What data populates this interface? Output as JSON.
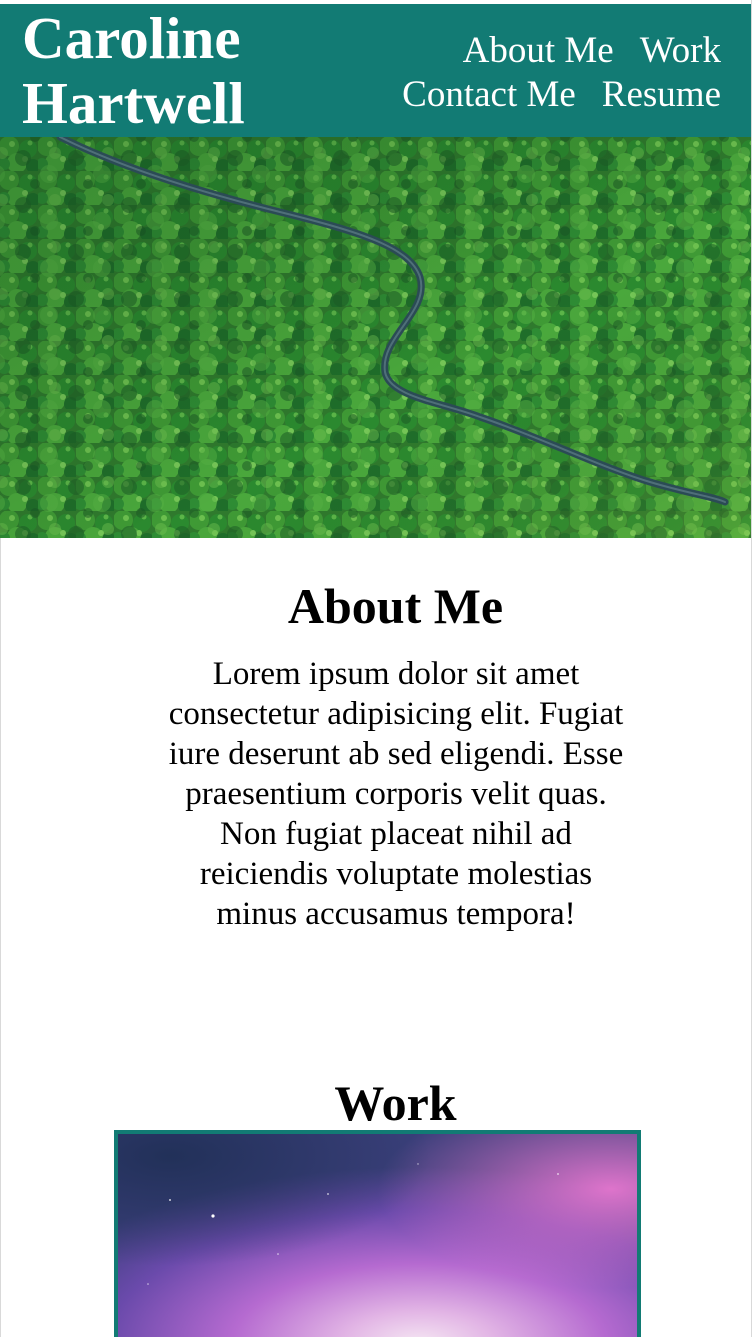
{
  "header": {
    "brand_line1": "Caroline",
    "brand_line2": "Hartwell",
    "background": "#127b74",
    "nav": [
      {
        "label": "About Me"
      },
      {
        "label": "Work"
      },
      {
        "label": "Contact Me"
      },
      {
        "label": "Resume"
      }
    ]
  },
  "hero": {
    "image": "aerial-forest-road-image"
  },
  "about": {
    "title": "About Me",
    "text": "Lorem ipsum dolor sit amet consectetur adipisicing elit. Fugiat iure deserunt ab sed eligendi. Esse praesentium corporis velit quas. Non fugiat placeat nihil ad reiciendis voluptate molestias minus accusamus tempora!"
  },
  "work": {
    "title": "Work",
    "card_image": "purple-nebula-image",
    "border_color": "#127b74"
  }
}
